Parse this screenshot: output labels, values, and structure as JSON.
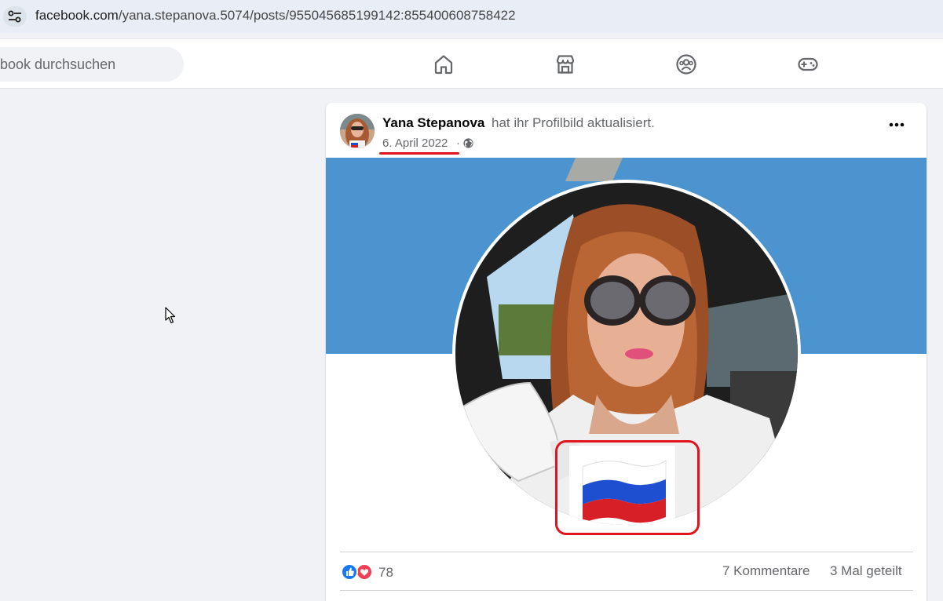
{
  "browser": {
    "url_host": "facebook.com",
    "url_path": "/yana.stepanova.5074/posts/955045685199142:855400608758422",
    "site_info_icon": "tune-icon"
  },
  "header": {
    "search_placeholder": "book durchsuchen",
    "nav_icons": [
      "home-icon",
      "marketplace-icon",
      "groups-icon",
      "gaming-icon"
    ]
  },
  "post": {
    "author": "Yana Stepanova",
    "action": "hat ihr Profilbild aktualisiert.",
    "date": "6. April 2022",
    "separator": "·",
    "audience_icon": "globe-icon",
    "more_icon": "more-options-icon",
    "reaction_count": "78",
    "reaction_icons": [
      "like-icon",
      "love-icon"
    ],
    "comments": "7 Kommentare",
    "shares": "3 Mal geteilt"
  },
  "annotations": {
    "highlight_color": "#e0141e"
  },
  "colors": {
    "cover_blue": "#4b94cf",
    "fb_blue": "#1877f2",
    "text_secondary": "#65676b"
  }
}
